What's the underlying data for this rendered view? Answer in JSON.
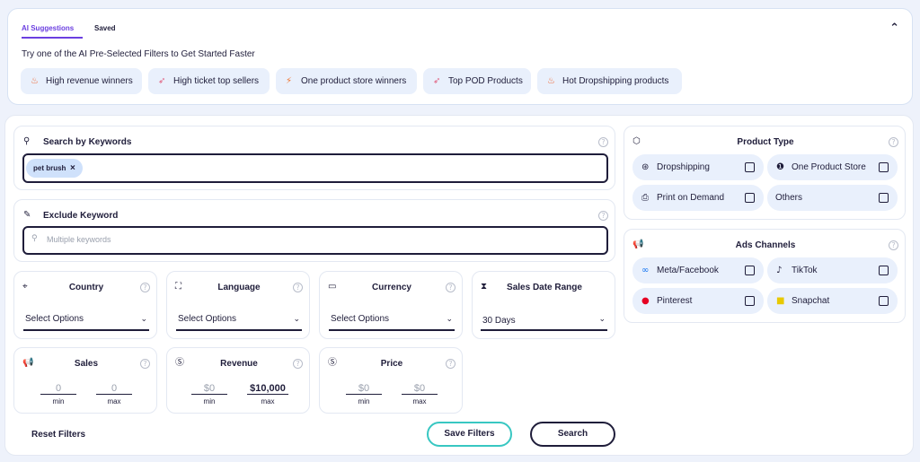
{
  "tabs": {
    "ai": "AI Suggestions",
    "saved": "Saved"
  },
  "intro": "Try one of the AI Pre-Selected Filters to Get Started Faster",
  "suggestions": [
    "High revenue winners",
    "High ticket top sellers",
    "One product store winners",
    "Top POD Products",
    "Hot Dropshipping products"
  ],
  "keywords": {
    "title": "Search by Keywords",
    "chip": "pet brush",
    "chip_remove": "×"
  },
  "exclude": {
    "title": "Exclude Keyword",
    "placeholder": "Multiple keywords"
  },
  "country": {
    "title": "Country",
    "value": "Select Options"
  },
  "language": {
    "title": "Language",
    "value": "Select Options"
  },
  "currency": {
    "title": "Currency",
    "value": "Select Options"
  },
  "date_range": {
    "title": "Sales Date Range",
    "value": "30 Days"
  },
  "sales": {
    "title": "Sales",
    "min": "0",
    "max": "0",
    "min_label": "min",
    "max_label": "max"
  },
  "revenue": {
    "title": "Revenue",
    "min": "$0",
    "max": "$10,000",
    "min_label": "min",
    "max_label": "max"
  },
  "price": {
    "title": "Price",
    "min": "$0",
    "max": "$0",
    "min_label": "min",
    "max_label": "max"
  },
  "product_type": {
    "title": "Product Type",
    "options": [
      "Dropshipping",
      "One Product Store",
      "Print on Demand",
      "Others"
    ]
  },
  "ads_channels": {
    "title": "Ads Channels",
    "options": [
      "Meta/Facebook",
      "TikTok",
      "Pinterest",
      "Snapchat"
    ]
  },
  "buttons": {
    "reset": "Reset Filters",
    "save": "Save Filters",
    "search": "Search"
  },
  "help_glyph": "?",
  "colors": {
    "accent": "#6b3fe0",
    "dark": "#1f1d3a",
    "teal": "#38c7c2",
    "chip": "#cfe1fb",
    "option_bg": "#e9f0fc"
  }
}
